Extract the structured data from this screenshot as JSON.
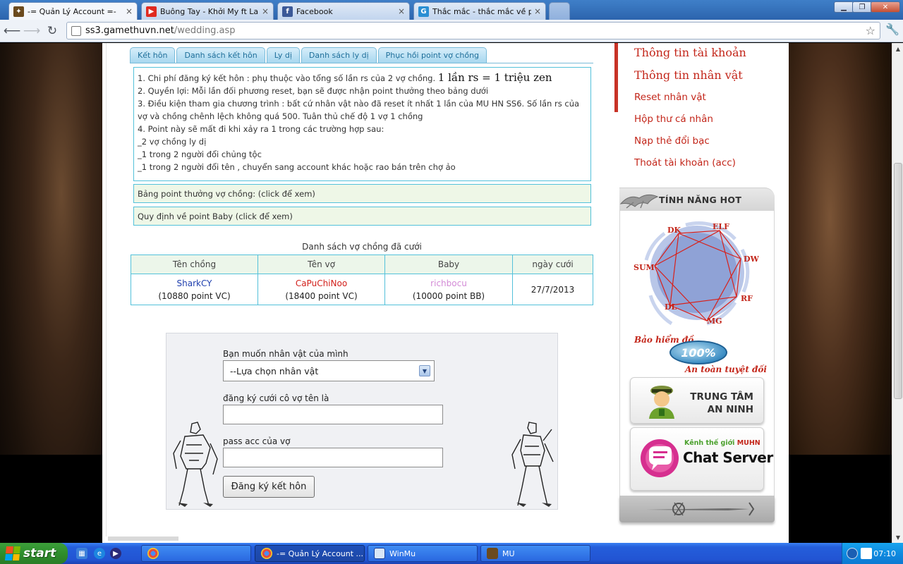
{
  "browser": {
    "tabs": [
      {
        "title": "-= Quản Lý Account =-",
        "active": true
      },
      {
        "title": "Buông Tay - Khởi My ft La Thăng"
      },
      {
        "title": "Facebook"
      },
      {
        "title": "Thắc mắc - thắc mắc về poi bị"
      }
    ],
    "close_glyph": "×",
    "url_host": "ss3.gamethuvn.net",
    "url_path": "/wedding.asp"
  },
  "content_tabs": [
    "Kết hôn",
    "Danh sách kết hôn",
    "Ly dị",
    "Danh sách ly dị",
    "Phục hồi point vợ chồng"
  ],
  "info": {
    "line1_prefix": "1. Chi phí đăng ký kết hôn : phụ thuộc vào tổng số lần rs của 2 vợ chồng.",
    "line1_big": "1 lần rs = 1 triệu zen",
    "line2": "2. Quyền lợi: Mỗi lần đối phương reset, bạn sẽ được nhận point thưởng theo bảng dưới",
    "line3": "3. Điều kiện tham gia chương trình : bất cứ nhân vật nào đã reset ít nhất 1 lần của MU HN SS6. Số lần rs của vợ và chồng chênh lệch không quá 500. Tuân thủ chế độ 1 vợ 1 chồng",
    "line4": "4. Point này sẽ mất đi khi xảy ra 1 trong các trường hợp sau:",
    "case1": "_2 vợ chồng ly dị",
    "case2": "_1 trong 2 người đổi chủng tộc",
    "case3": "_1 trong 2 người đổi tên , chuyển sang account khác hoặc rao bán trên chợ ảo"
  },
  "clickboxes": {
    "reward_table": "Bảng point thưởng vợ chồng: (click để xem)",
    "baby_rules": "Quy định về point Baby (click để xem)"
  },
  "married_table": {
    "caption": "Danh sách vợ chồng đã cưới",
    "headers": [
      "Tên chồng",
      "Tên vợ",
      "Baby",
      "ngày cưới"
    ],
    "rows": [
      {
        "husband": "SharkCY",
        "husband_points": "(10880 point VC)",
        "wife": "CaPuChiNoo",
        "wife_points": "(18400 point VC)",
        "baby": "richbocu",
        "baby_points": "(10000 point BB)",
        "date": "27/7/2013"
      }
    ]
  },
  "register_form": {
    "select_label": "Bạn muốn nhân vật của mình",
    "select_value": "--Lựa chọn nhân vật",
    "wife_label": "đăng ký cưới  cô vợ tên là",
    "wife_value": "",
    "pass_label": "pass acc của vợ",
    "pass_value": "",
    "submit_label": "Đăng ký kết hôn"
  },
  "sidebar": {
    "menu": [
      {
        "label": "Thông tin tài khoản",
        "size": "big"
      },
      {
        "label": "Thông tin nhân vật",
        "size": "big"
      },
      {
        "label": "Reset nhân vật",
        "size": "small"
      },
      {
        "label": "Hộp thư cá nhân",
        "size": "small"
      },
      {
        "label": "Nạp thẻ đổi bạc",
        "size": "small"
      },
      {
        "label": "Thoát tài khoản (acc)",
        "size": "small"
      }
    ],
    "hot_title": "TÍNH NĂNG HOT",
    "class_wheel": [
      "DK",
      "ELF",
      "DW",
      "RF",
      "MG",
      "DL",
      "SUM"
    ],
    "insurance_line1": "Bảo hiểm đồ",
    "insurance_badge": "100%",
    "insurance_line2": "An toàn tuyệt đối",
    "security_line1": "TRUNG TÂM",
    "security_line2": "AN NINH",
    "chat_sub_prefix": "Kênh thế giới",
    "chat_sub_brand": "MUHN",
    "chat_main": "Chat Server"
  },
  "taskbar": {
    "start_label": "start",
    "buttons": [
      "",
      "-= Quản Lý Account ...",
      "WinMu",
      "MU"
    ],
    "clock": "07:10"
  },
  "colors": {
    "accent_red": "#c3261a",
    "table_border": "#53c1da",
    "tab_text": "#1f6f9a"
  }
}
